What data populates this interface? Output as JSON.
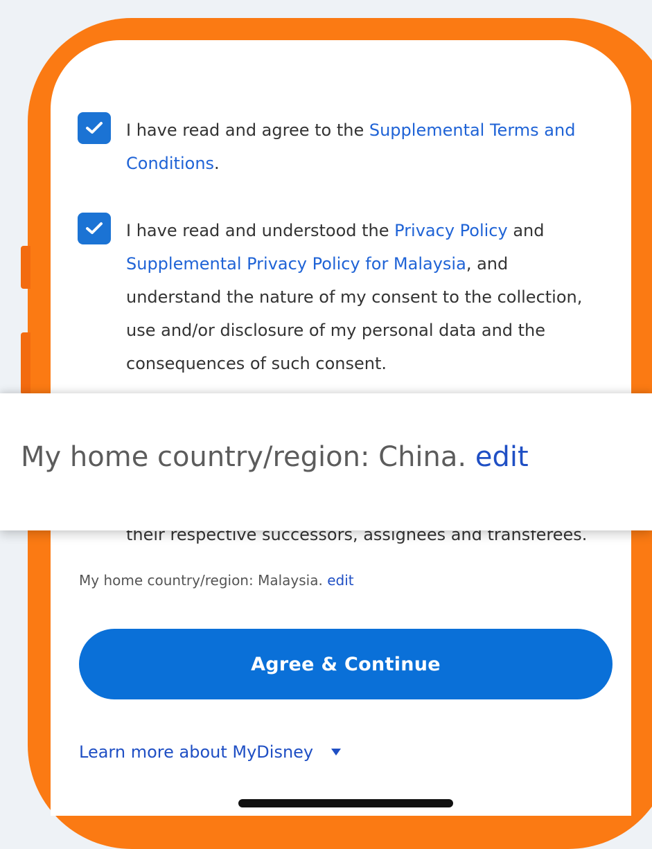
{
  "consents": [
    {
      "checked": true,
      "text_before": "I have read and agree to the ",
      "link1": "Supplemental Terms and Conditions",
      "text_after": "."
    },
    {
      "checked": true,
      "text_before": "I have read and understood the ",
      "link1": "Privacy Policy",
      "text_middle": " and ",
      "link2": "Supplemental Privacy Policy for Malaysia",
      "text_after": ", and understand the nature of my consent to the collection, use and/or disclosure of my personal data and the consequences of such consent."
    }
  ],
  "cut_off_text": "their respective successors, assignees and transferees.",
  "banner": {
    "label": "My home country/region: China. ",
    "edit_label": "edit"
  },
  "home_region": {
    "label": "My home country/region: Malaysia. ",
    "edit_label": "edit"
  },
  "agree_button_label": "Agree & Continue",
  "learn_more_label": "Learn more about MyDisney",
  "colors": {
    "frame": "#fb7a13",
    "primary": "#0a70d8",
    "link": "#1f63d6"
  }
}
